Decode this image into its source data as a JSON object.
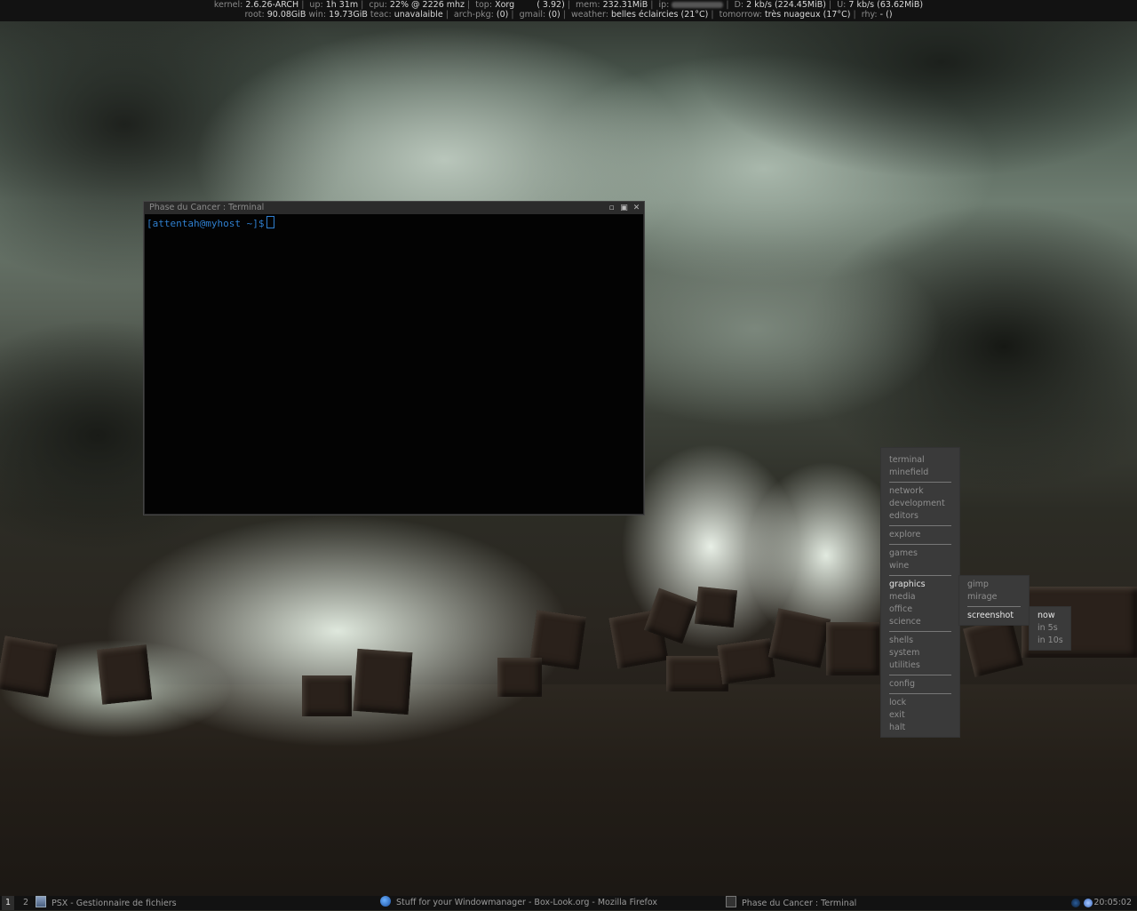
{
  "statusbar": {
    "row1": {
      "kernel_label": "kernel:",
      "kernel": "2.6.26-ARCH",
      "up_label": "up:",
      "up": "1h 31m",
      "cpu_label": "cpu:",
      "cpu": "22% @ 2226 mhz",
      "top_label": "top:",
      "top": "Xorg",
      "top_val": "( 3.92)",
      "mem_label": "mem:",
      "mem": "232.31MiB",
      "ip_label": "ip:",
      "down_label": "D:",
      "down": "2 kb/s",
      "down_total": "(224.45MiB)",
      "up_rate_label": "U:",
      "up_rate": "7 kb/s",
      "up_total": "(63.62MiB)"
    },
    "row2": {
      "root_label": "root:",
      "root": "90.08GiB",
      "win_label": "win:",
      "win": "19.73GiB",
      "teac_label": "teac:",
      "teac": "unavalaible",
      "arch_label": "arch-pkg:",
      "arch": "(0)",
      "gmail_label": "gmail:",
      "gmail": "(0)",
      "weather_label": "weather:",
      "weather": "belles éclaircies",
      "weather_temp": "(21°C)",
      "tomorrow_label": "tomorrow:",
      "tomorrow": "très nuageux",
      "tomorrow_temp": "(17°C)",
      "rhy_label": "rhy:",
      "rhy": "- ()"
    }
  },
  "terminal": {
    "title": "Phase du Cancer : Terminal",
    "prompt": "[attentah@myhost ~]$"
  },
  "menu": {
    "groups": [
      [
        "terminal",
        "minefield"
      ],
      [
        "network",
        "development",
        "editors"
      ],
      [
        "explore"
      ],
      [
        "games",
        "wine"
      ],
      [
        "graphics",
        "media",
        "office",
        "science"
      ],
      [
        "shells",
        "system",
        "utilities"
      ],
      [
        "config"
      ],
      [
        "lock",
        "exit",
        "halt"
      ]
    ],
    "active": "graphics"
  },
  "graphics_menu": {
    "items": [
      "gimp",
      "mirage"
    ],
    "submenu": "screenshot"
  },
  "screenshot_menu": {
    "items": [
      "now",
      "in 5s",
      "in 10s"
    ],
    "active": "now"
  },
  "taskbar": {
    "workspaces": [
      "1",
      "2"
    ],
    "current_workspace": "1",
    "tasks": [
      "PSX - Gestionnaire de fichiers",
      "Stuff for your Windowmanager - Box-Look.org - Mozilla Firefox",
      "Phase du Cancer : Terminal"
    ],
    "clock": "20:05:02"
  },
  "colors": {
    "bar_bg": "#121212",
    "menu_bg": "#3a3a3a",
    "prompt": "#2f7fcf"
  }
}
